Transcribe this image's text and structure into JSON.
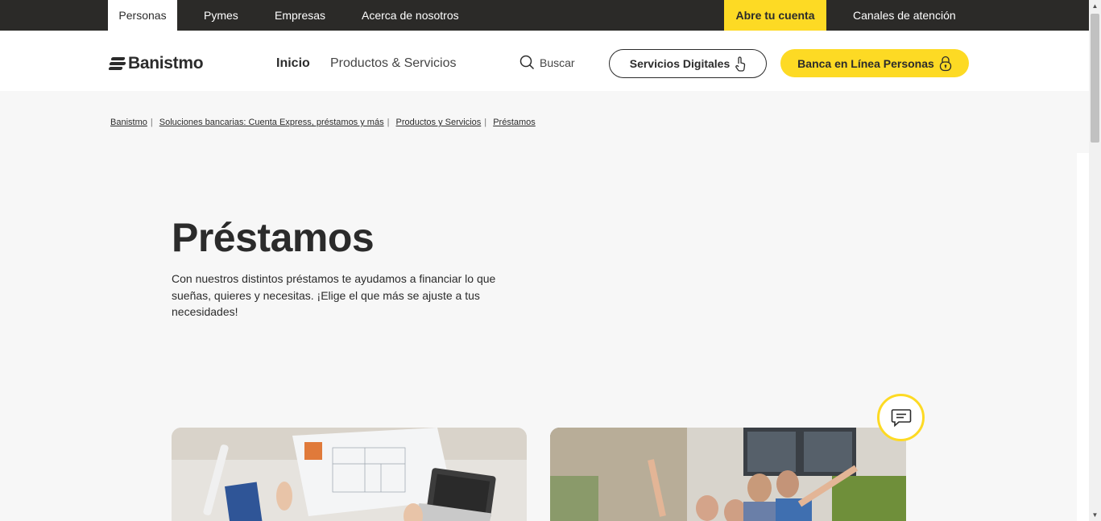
{
  "topbar": {
    "tabs": [
      "Personas",
      "Pymes",
      "Empresas",
      "Acerca de nosotros"
    ],
    "cta": "Abre tu cuenta",
    "channels": "Canales de atención"
  },
  "header": {
    "logo": "Banistmo",
    "nav": [
      "Inicio",
      "Productos & Servicios"
    ],
    "search_label": "Buscar",
    "digital_services": "Servicios Digitales",
    "online_banking": "Banca en Línea Personas"
  },
  "breadcrumb": [
    "Banistmo",
    "Soluciones bancarias: Cuenta Express, préstamos y más",
    "Productos y Servicios",
    "Préstamos"
  ],
  "hero": {
    "title": "Préstamos",
    "description": "Con nuestros distintos préstamos te ayudamos a financiar lo que sueñas, quieres y necesitas. ¡Elige el que más se ajuste a tus necesidades!"
  },
  "colors": {
    "brand_yellow": "#fdda24",
    "dark": "#2b2a28"
  }
}
